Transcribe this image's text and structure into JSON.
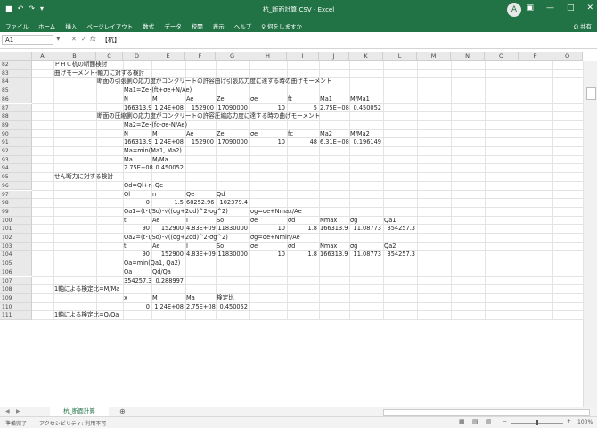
{
  "window": {
    "title": "杭_断面計算.CSV - Excel",
    "user_initial": "A",
    "ribbon_display": "▣",
    "minimize": "—",
    "maximize": "□",
    "close": "✕"
  },
  "quick_access": {
    "save_icon": "■",
    "undo_icon": "↶",
    "redo_icon": "↷",
    "customize_icon": "▾"
  },
  "ribbon": {
    "tabs": [
      "ファイル",
      "ホーム",
      "挿入",
      "ページレイアウト",
      "数式",
      "データ",
      "校閲",
      "表示",
      "ヘルプ",
      "♀ 何をしますか"
    ],
    "share": "Ω 共有"
  },
  "formula_bar": {
    "namebox": "A1",
    "cancel": "✕",
    "enter": "✓",
    "fx": "fx",
    "content": "【杭】"
  },
  "columns": [
    "A",
    "B",
    "C",
    "D",
    "E",
    "F",
    "G",
    "H",
    "I",
    "J",
    "K",
    "L",
    "M",
    "N",
    "O",
    "P",
    "Q"
  ],
  "rows": [
    {
      "n": "82",
      "cells": [
        [
          "B",
          "ＰＨＣ杭の断面検討"
        ]
      ]
    },
    {
      "n": "83",
      "cells": [
        [
          "B",
          "曲げモーメント-軸力に対する検討"
        ]
      ]
    },
    {
      "n": "84",
      "cells": [
        [
          "C",
          "  断面の引張側の応力度がコンクリートの許容曲げ引張応力度に達する時の曲げモーメント"
        ]
      ]
    },
    {
      "n": "85",
      "cells": [
        [
          "D",
          "Ma1=Ze･(ft+σe+N/Ae)"
        ]
      ]
    },
    {
      "n": "86",
      "cells": [
        [
          "D",
          "N"
        ],
        [
          "E",
          "M"
        ],
        [
          "F",
          "Ae"
        ],
        [
          "G",
          "Ze"
        ],
        [
          "H",
          "σe"
        ],
        [
          "I",
          "ft"
        ],
        [
          "J",
          "Ma1"
        ],
        [
          "K",
          "M/Ma1"
        ]
      ]
    },
    {
      "n": "87",
      "cells": [
        [
          "D",
          "166313.9",
          "r"
        ],
        [
          "E",
          "1.24E+08",
          "r"
        ],
        [
          "F",
          "152900",
          "r"
        ],
        [
          "G",
          "17090000",
          "r"
        ],
        [
          "H",
          "10",
          "r"
        ],
        [
          "I",
          "5",
          "r"
        ],
        [
          "J",
          "2.75E+08",
          "r"
        ],
        [
          "K",
          "0.450052",
          "r"
        ]
      ]
    },
    {
      "n": "88",
      "cells": [
        [
          "C",
          "  断面の圧縮側の応力度がコンクリートの許容圧縮応力度に達する時の曲げモーメント"
        ]
      ]
    },
    {
      "n": "89",
      "cells": [
        [
          "D",
          "Ma2=Ze･(fc-σe-N/Ae)"
        ]
      ]
    },
    {
      "n": "90",
      "cells": [
        [
          "D",
          "N"
        ],
        [
          "E",
          "M"
        ],
        [
          "F",
          "Ae"
        ],
        [
          "G",
          "Ze"
        ],
        [
          "H",
          "σe"
        ],
        [
          "I",
          "fc"
        ],
        [
          "J",
          "Ma2"
        ],
        [
          "K",
          "M/Ma2"
        ]
      ]
    },
    {
      "n": "91",
      "cells": [
        [
          "D",
          "166313.9",
          "r"
        ],
        [
          "E",
          "1.24E+08",
          "r"
        ],
        [
          "F",
          "152900",
          "r"
        ],
        [
          "G",
          "17090000",
          "r"
        ],
        [
          "H",
          "10",
          "r"
        ],
        [
          "I",
          "48",
          "r"
        ],
        [
          "J",
          "6.31E+08",
          "r"
        ],
        [
          "K",
          "0.196149",
          "r"
        ]
      ]
    },
    {
      "n": "92",
      "cells": [
        [
          "D",
          "Ma=min(Ma1, Ma2)"
        ]
      ]
    },
    {
      "n": "93",
      "cells": [
        [
          "D",
          "Ma"
        ],
        [
          "E",
          "M/Ma"
        ]
      ]
    },
    {
      "n": "94",
      "cells": [
        [
          "D",
          "2.75E+08",
          "r"
        ],
        [
          "E",
          "0.450052",
          "r"
        ]
      ]
    },
    {
      "n": "95",
      "cells": [
        [
          "B",
          "せん断力に対する検討"
        ]
      ]
    },
    {
      "n": "96",
      "cells": [
        [
          "D",
          "Qd=Ql+n･Qe"
        ]
      ]
    },
    {
      "n": "97",
      "cells": [
        [
          "D",
          "Ql"
        ],
        [
          "E",
          "n"
        ],
        [
          "F",
          "Qe"
        ],
        [
          "G",
          "Qd"
        ]
      ]
    },
    {
      "n": "98",
      "cells": [
        [
          "D",
          "0",
          "r"
        ],
        [
          "E",
          "1.5",
          "r"
        ],
        [
          "F",
          "68252.96",
          "r"
        ],
        [
          "G",
          "102379.4",
          "r"
        ]
      ]
    },
    {
      "n": "99",
      "cells": [
        [
          "D",
          "Qa1=(t･I/So)･√((σg+2σd)^2-σg^2)"
        ],
        [
          "H",
          "σg=σe+Nmax/Ae"
        ]
      ]
    },
    {
      "n": "100",
      "cells": [
        [
          "D",
          "t"
        ],
        [
          "E",
          "Ae"
        ],
        [
          "F",
          "I"
        ],
        [
          "G",
          "So"
        ],
        [
          "H",
          "σe"
        ],
        [
          "I",
          "σd"
        ],
        [
          "J",
          "Nmax"
        ],
        [
          "K",
          "σg"
        ],
        [
          "L",
          "Qa1"
        ]
      ]
    },
    {
      "n": "101",
      "cells": [
        [
          "D",
          "90",
          "r"
        ],
        [
          "E",
          "152900",
          "r"
        ],
        [
          "F",
          "4.83E+09",
          "r"
        ],
        [
          "G",
          "11830000",
          "r"
        ],
        [
          "H",
          "10",
          "r"
        ],
        [
          "I",
          "1.8",
          "r"
        ],
        [
          "J",
          "166313.9",
          "r"
        ],
        [
          "K",
          "11.08773",
          "r"
        ],
        [
          "L",
          "354257.3",
          "r"
        ]
      ]
    },
    {
      "n": "102",
      "cells": [
        [
          "D",
          "Qa2=(t･I/So)･√((σg+2σd)^2-σg^2)"
        ],
        [
          "H",
          "σg=σe+Nmin/Ae"
        ]
      ]
    },
    {
      "n": "103",
      "cells": [
        [
          "D",
          "t"
        ],
        [
          "E",
          "Ae"
        ],
        [
          "F",
          "I"
        ],
        [
          "G",
          "So"
        ],
        [
          "H",
          "σe"
        ],
        [
          "I",
          "σd"
        ],
        [
          "J",
          "Nmax"
        ],
        [
          "K",
          "σg"
        ],
        [
          "L",
          "Qa2"
        ]
      ]
    },
    {
      "n": "104",
      "cells": [
        [
          "D",
          "90",
          "r"
        ],
        [
          "E",
          "152900",
          "r"
        ],
        [
          "F",
          "4.83E+09",
          "r"
        ],
        [
          "G",
          "11830000",
          "r"
        ],
        [
          "H",
          "10",
          "r"
        ],
        [
          "I",
          "1.8",
          "r"
        ],
        [
          "J",
          "166313.9",
          "r"
        ],
        [
          "K",
          "11.08773",
          "r"
        ],
        [
          "L",
          "354257.3",
          "r"
        ]
      ]
    },
    {
      "n": "105",
      "cells": [
        [
          "D",
          "Qa=min(Qa1, Qa2)"
        ]
      ]
    },
    {
      "n": "106",
      "cells": [
        [
          "D",
          "Qa"
        ],
        [
          "E",
          "Qd/Qa"
        ]
      ]
    },
    {
      "n": "107",
      "cells": [
        [
          "D",
          "354257.3",
          "r"
        ],
        [
          "E",
          "0.288997",
          "r"
        ]
      ]
    },
    {
      "n": "108",
      "cells": [
        [
          "B",
          "1軸による検定比=M/Ma"
        ]
      ]
    },
    {
      "n": "109",
      "cells": [
        [
          "D",
          "x"
        ],
        [
          "E",
          "M"
        ],
        [
          "F",
          "Ma"
        ],
        [
          "G",
          "検定比"
        ]
      ]
    },
    {
      "n": "110",
      "cells": [
        [
          "D",
          "0",
          "r"
        ],
        [
          "E",
          "1.24E+08",
          "r"
        ],
        [
          "F",
          "2.75E+08",
          "r"
        ],
        [
          "G",
          "0.450052",
          "r"
        ]
      ]
    },
    {
      "n": "111",
      "cells": [
        [
          "B",
          "1軸による検定比=Q/Qa"
        ]
      ]
    }
  ],
  "sheet": {
    "tab": "杭_断面計算",
    "add": "⊕",
    "nav_prev": "◀",
    "nav_next": "▶"
  },
  "status": {
    "mode": "準備完了",
    "accessibility": "アクセシビリティ: 利用不可",
    "zoom": "100%",
    "view_normal": "▦",
    "view_layout": "▤",
    "view_break": "▥",
    "zoom_out": "−",
    "zoom_in": "+"
  },
  "colors": {
    "accent": "#217346"
  }
}
